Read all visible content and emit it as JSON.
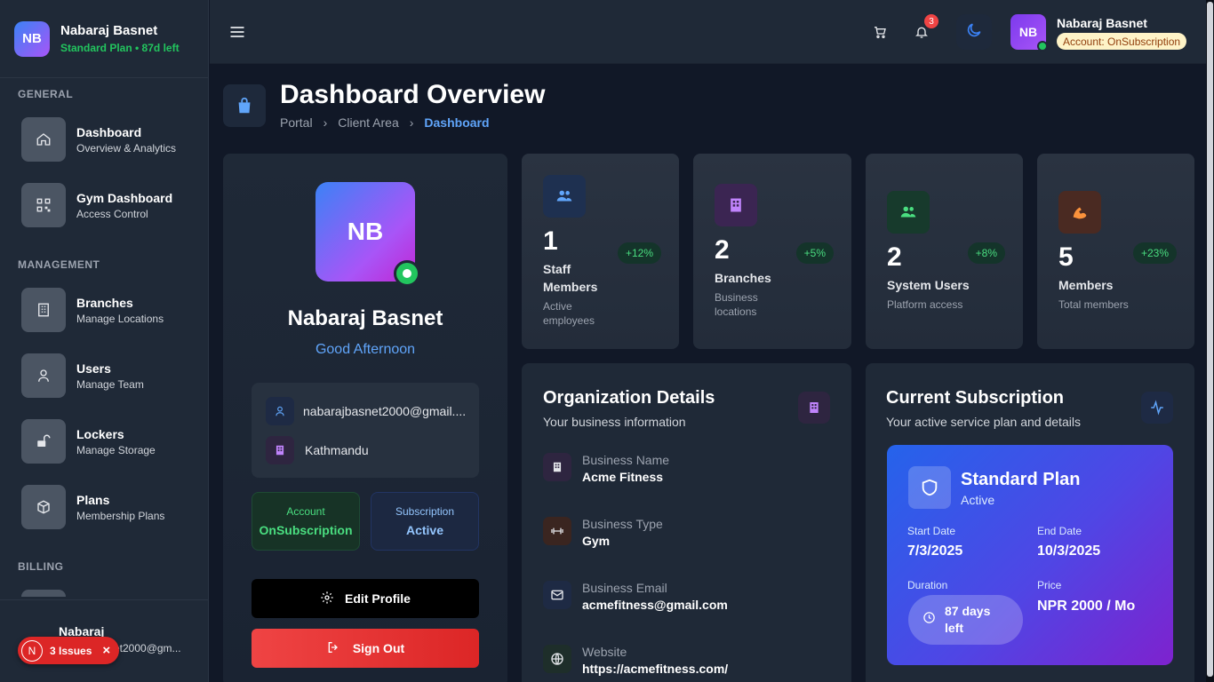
{
  "brand": {
    "initials": "NB",
    "name": "Nabaraj Basnet",
    "plan": "Standard Plan • 87d left"
  },
  "sidebar": {
    "sections": [
      "GENERAL",
      "MANAGEMENT",
      "BILLING"
    ],
    "items": [
      {
        "title": "Dashboard",
        "subtitle": "Overview & Analytics",
        "icon": "home-icon"
      },
      {
        "title": "Gym Dashboard",
        "subtitle": "Access Control",
        "icon": "qr-icon"
      },
      {
        "title": "Branches",
        "subtitle": "Manage Locations",
        "icon": "building-icon"
      },
      {
        "title": "Users",
        "subtitle": "Manage Team",
        "icon": "user-icon"
      },
      {
        "title": "Lockers",
        "subtitle": "Manage Storage",
        "icon": "lock-icon"
      },
      {
        "title": "Plans",
        "subtitle": "Membership Plans",
        "icon": "box-icon"
      }
    ],
    "footer": {
      "name": "Nabaraj",
      "email": "et2000@gm..."
    },
    "issues": {
      "initial": "N",
      "label": "3 Issues"
    }
  },
  "topbar": {
    "notification_count": "3",
    "user_initials": "NB",
    "user_name": "Nabaraj Basnet",
    "account_badge": "Account: OnSubscription"
  },
  "page": {
    "title": "Dashboard Overview",
    "breadcrumb": [
      "Portal",
      "Client Area",
      "Dashboard"
    ]
  },
  "profile": {
    "initials": "NB",
    "name": "Nabaraj Basnet",
    "greeting": "Good Afternoon",
    "email": "nabarajbasnet2000@gmail....",
    "location": "Kathmandu",
    "account_label": "Account",
    "account_value": "OnSubscription",
    "subscription_label": "Subscription",
    "subscription_value": "Active",
    "edit_label": "Edit Profile",
    "signout_label": "Sign Out"
  },
  "stats": [
    {
      "value": "1",
      "label": "Staff Members",
      "sub": "Active employees",
      "change": "+12%",
      "icon": "users-icon",
      "color": "#60a5fa"
    },
    {
      "value": "2",
      "label": "Branches",
      "sub": "Business locations",
      "change": "+5%",
      "icon": "building-icon",
      "color": "#c084fc"
    },
    {
      "value": "2",
      "label": "System Users",
      "sub": "Platform access",
      "change": "+8%",
      "icon": "users-icon",
      "color": "#4ade80"
    },
    {
      "value": "5",
      "label": "Members",
      "sub": "Total members",
      "change": "+23%",
      "icon": "muscle-icon",
      "color": "#fb923c"
    }
  ],
  "org": {
    "title": "Organization Details",
    "subtitle": "Your business information",
    "rows": [
      {
        "key": "Business Name",
        "value": "Acme Fitness",
        "icon": "building-icon"
      },
      {
        "key": "Business Type",
        "value": "Gym",
        "icon": "dumbbell-icon"
      },
      {
        "key": "Business Email",
        "value": "acmefitness@gmail.com",
        "icon": "mail-icon"
      },
      {
        "key": "Website",
        "value": "https://acmefitness.com/",
        "icon": "globe-icon"
      }
    ]
  },
  "subscription": {
    "title": "Current Subscription",
    "subtitle": "Your active service plan and details",
    "plan_name": "Standard Plan",
    "status": "Active",
    "start_label": "Start Date",
    "start": "7/3/2025",
    "end_label": "End Date",
    "end": "10/3/2025",
    "duration_label": "Duration",
    "duration": "87 days left",
    "price_label": "Price",
    "price": "NPR 2000 / Mo"
  },
  "colors": {
    "accent": "#3b82f6",
    "success": "#22c55e",
    "danger": "#ef4444",
    "purple": "#a855f7"
  }
}
